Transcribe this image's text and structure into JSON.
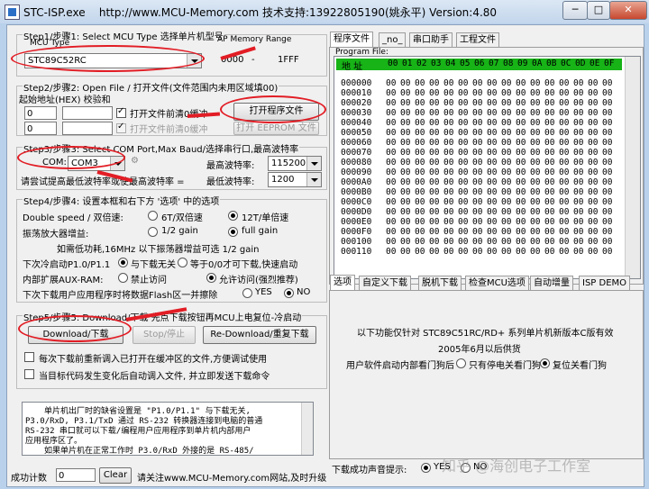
{
  "window": {
    "title_left": "STC-ISP.exe",
    "title_mid": "http://www.MCU-Memory.com 技术支持:13922805190(姚永平) Version:4.80",
    "minimize": "─",
    "maximize": "□",
    "close": "✕"
  },
  "step1": {
    "title": "Step1/步骤1: Select MCU Type  选择单片机型号",
    "mcu_type_label": "MCU Type",
    "ap_label": "AP Memory Range",
    "mcu_value": "STC89C52RC",
    "range_start": "0000",
    "range_dash": "-",
    "range_end": "1FFF"
  },
  "step2": {
    "title": "Step2/步骤2: Open File / 打开文件(文件范围内未用区域填00)",
    "addr_label": "起始地址(HEX) 校验和",
    "addr1": "0",
    "addr2": "0",
    "chk1_label": "打开文件前清0缓冲",
    "chk2_label": "打开文件前清0缓冲",
    "open_program_button": "打开程序文件",
    "open_eeprom_button": "打开 EEPROM 文件"
  },
  "step3": {
    "title": "Step3/步骤3: Select COM Port,Max Baud/选择串行口,最高波特率",
    "com_label": "COM:",
    "com_value": "COM3",
    "max_baud_label": "最高波特率:",
    "max_baud_value": "115200",
    "min_baud_label": "最低波特率:",
    "min_baud_value": "1200",
    "hint": "请尝试提高最低波特率或使最高波特率 ="
  },
  "step4": {
    "title": "Step4/步骤4: 设置本框和右下方 '选项' 中的选项",
    "double_speed_label": "Double speed / 双倍速:",
    "opt_6t": "6T/双倍速",
    "opt_12t": "12T/单倍速",
    "osc_gain_label": "振荡放大器增益:",
    "opt_half_gain": "1/2 gain",
    "opt_full_gain": "full gain",
    "note1": "如需低功耗,16MHz 以下振荡器增益可选 1/2 gain",
    "p1_label": "下次冷启动P1.0/P1.1",
    "p1_opt1": "与下载无关",
    "p1_opt2": "等于0/0才可下载,快速启动",
    "aux_label": "内部扩展AUX-RAM:",
    "aux_opt1": "禁止访问",
    "aux_opt2": "允许访问(强烈推荐)",
    "flash_label": "下次下载用户应用程序时将数据Flash区一并擦除",
    "yes": "YES",
    "no": "NO"
  },
  "step5": {
    "title": "Step5/步骤5: Download/下载  先点下载按钮再MCU上电复位-冷启动",
    "download_button": "Download/下载",
    "stop_button": "Stop/停止",
    "redownload_button": "Re-Download/重复下载",
    "chk1": "每次下载前重新调入已打开在缓冲区的文件,方便调试使用",
    "chk2": "当目标代码发生变化后自动调入文件, 并立即发送下载命令"
  },
  "info_text": [
    "单片机出厂时的缺省设置是 \"P1.0/P1.1\" 与下载无关,",
    "P3.0/RxD, P3.1/TxD 通过 RS-232 转换器连接到电脑的普通",
    "RS-232 串口就可以下载/编程用户应用程序到单片机内部用户",
    "应用程序区了。",
    "如果单片机在正常工作时 P3.0/RxD 外接的是 RS-485/"
  ],
  "status": {
    "count_label": "成功计数",
    "count_value": "0",
    "clear_button": "Clear",
    "link_text": "请关注www.MCU-Memory.com网站,及时升级"
  },
  "right_tabs": [
    "程序文件",
    "_no_",
    "串口助手",
    "工程文件"
  ],
  "program_file_label": "Program File:",
  "hex": {
    "header_addr": "地 址",
    "header_cols": [
      "00",
      "01",
      "02",
      "03",
      "04",
      "05",
      "06",
      "07",
      "08",
      "09",
      "0A",
      "0B",
      "0C",
      "0D",
      "0E",
      "0F"
    ],
    "addresses": [
      "000000",
      "000010",
      "000020",
      "000030",
      "000040",
      "000050",
      "000060",
      "000070",
      "000080",
      "000090",
      "0000A0",
      "0000B0",
      "0000C0",
      "0000D0",
      "0000E0",
      "0000F0",
      "000100",
      "000110"
    ],
    "fill": "00"
  },
  "bottom_tabs": [
    "选项",
    "自定义下载",
    "脱机下载",
    "检查MCU选项",
    "自动增量",
    "ISP DEMO"
  ],
  "options_panel": {
    "line1": "以下功能仅针对 STC89C51RC/RD+ 系列单片机新版本C版有效",
    "line2": "2005年6月以后供货",
    "line3_label": "用户软件启动内部看门狗后",
    "opt1": "只有停电关看门狗",
    "opt2": "复位关看门狗"
  },
  "sound": {
    "label": "下载成功声音提示:",
    "yes": "YES",
    "no": "NO"
  },
  "watermark": "知乎 @海创电子工作室"
}
